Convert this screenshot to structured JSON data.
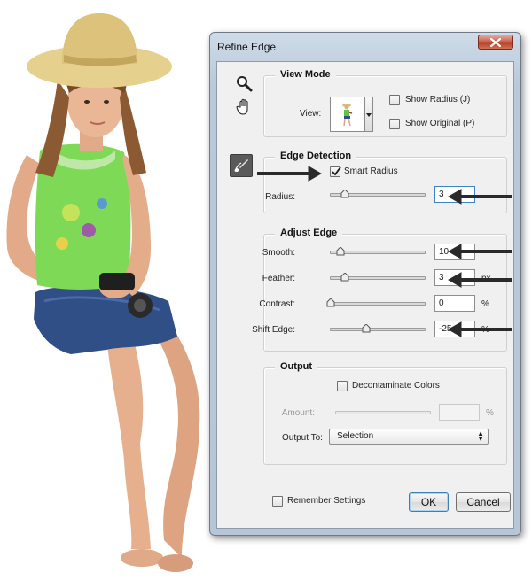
{
  "dialog": {
    "title": "Refine Edge",
    "view_mode": {
      "title": "View Mode",
      "view_label": "View:",
      "show_radius": {
        "label": "Show Radius (J)",
        "checked": false
      },
      "show_original": {
        "label": "Show Original (P)",
        "checked": false
      }
    },
    "edge_detection": {
      "title": "Edge Detection",
      "smart_radius": {
        "label": "Smart Radius",
        "checked": true
      },
      "radius": {
        "label": "Radius:",
        "value": "3"
      }
    },
    "adjust_edge": {
      "title": "Adjust Edge",
      "smooth": {
        "label": "Smooth:",
        "value": "10"
      },
      "feather": {
        "label": "Feather:",
        "value": "3",
        "unit": "px"
      },
      "contrast": {
        "label": "Contrast:",
        "value": "0",
        "unit": "%"
      },
      "shift_edge": {
        "label": "Shift Edge:",
        "value": "-25",
        "unit": "%"
      }
    },
    "output": {
      "title": "Output",
      "decontaminate": {
        "label": "Decontaminate Colors",
        "checked": false
      },
      "amount": {
        "label": "Amount:",
        "value": "",
        "unit": "%"
      },
      "output_to": {
        "label": "Output To:",
        "value": "Selection"
      }
    },
    "remember_settings": {
      "label": "Remember Settings",
      "checked": false
    },
    "ok_label": "OK",
    "cancel_label": "Cancel"
  },
  "colors": {
    "title_bar": "#c3d3e4",
    "close_button": "#c7503a",
    "dialog_bg": "#f0f0f0",
    "focus_border": "#3d83c9",
    "arrow": "#2a2a2a"
  },
  "icons": [
    "zoom-icon",
    "hand-icon",
    "refine-radius-brush-icon",
    "close-icon",
    "checkmark-icon",
    "dropdown-arrow-icon"
  ]
}
